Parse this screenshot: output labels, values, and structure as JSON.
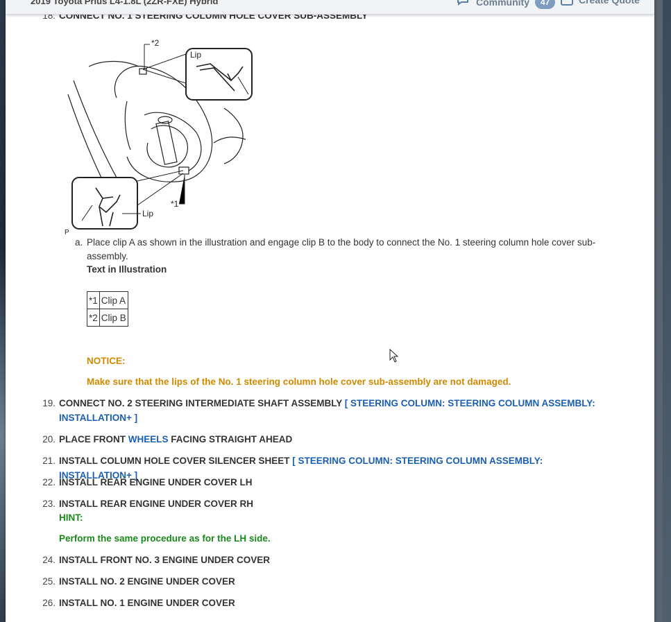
{
  "topbar": {
    "vehicle": "2019 Toyota Prius L4-1.8L (2ZR-FXE) Hybrid",
    "community_label": "Community",
    "community_count": "47",
    "quote_label": "Create Quote"
  },
  "steps": [
    {
      "num": "18.",
      "text": "CONNECT NO. 1 STEERING COLUMN HOLE COVER SUB-ASSEMBLY"
    },
    {
      "num": "19.",
      "text": "CONNECT NO. 2 STEERING INTERMEDIATE SHAFT ASSEMBLY ",
      "link": "[ STEERING COLUMN: STEERING COLUMN ASSEMBLY: INSTALLATION+ ]"
    },
    {
      "num": "20.",
      "text_pre": "PLACE FRONT ",
      "link": "WHEELS",
      "text_post": " FACING STRAIGHT AHEAD"
    },
    {
      "num": "21.",
      "text": "INSTALL COLUMN HOLE COVER SILENCER SHEET ",
      "link": "[ STEERING COLUMN: STEERING COLUMN ASSEMBLY: INSTALLATION+ ]"
    },
    {
      "num": "22.",
      "text": "INSTALL REAR ENGINE UNDER COVER LH"
    },
    {
      "num": "23.",
      "text": "INSTALL REAR ENGINE UNDER COVER RH"
    },
    {
      "num": "24.",
      "text": "INSTALL FRONT NO. 3 ENGINE UNDER COVER"
    },
    {
      "num": "25.",
      "text": "INSTALL NO. 2 ENGINE UNDER COVER"
    },
    {
      "num": "26.",
      "text": "INSTALL NO. 1 ENGINE UNDER COVER"
    }
  ],
  "illustration": {
    "callout_top": "*2",
    "callout_bottom": "*1",
    "lip_top": "Lip",
    "lip_bottom": "Lip",
    "corner_mark": "P"
  },
  "substep": {
    "marker": "a.",
    "text": "Place clip A as shown in the illustration and engage clip B to the body to connect the No. 1 steering column hole cover sub-assembly."
  },
  "text_in_illustration": "Text in Illustration",
  "legend": [
    {
      "key": "*1",
      "value": "Clip A"
    },
    {
      "key": "*2",
      "value": "Clip B"
    }
  ],
  "notice": {
    "label": "NOTICE:",
    "text": "Make sure that the lips of the No. 1 steering column hole cover sub-assembly are not damaged."
  },
  "hint": {
    "label": "HINT:",
    "text": "Perform the same procedure as for the LH side."
  },
  "colors": {
    "link": "#1a5fb4",
    "notice": "#d28a00",
    "hint": "#1a8a1a"
  }
}
